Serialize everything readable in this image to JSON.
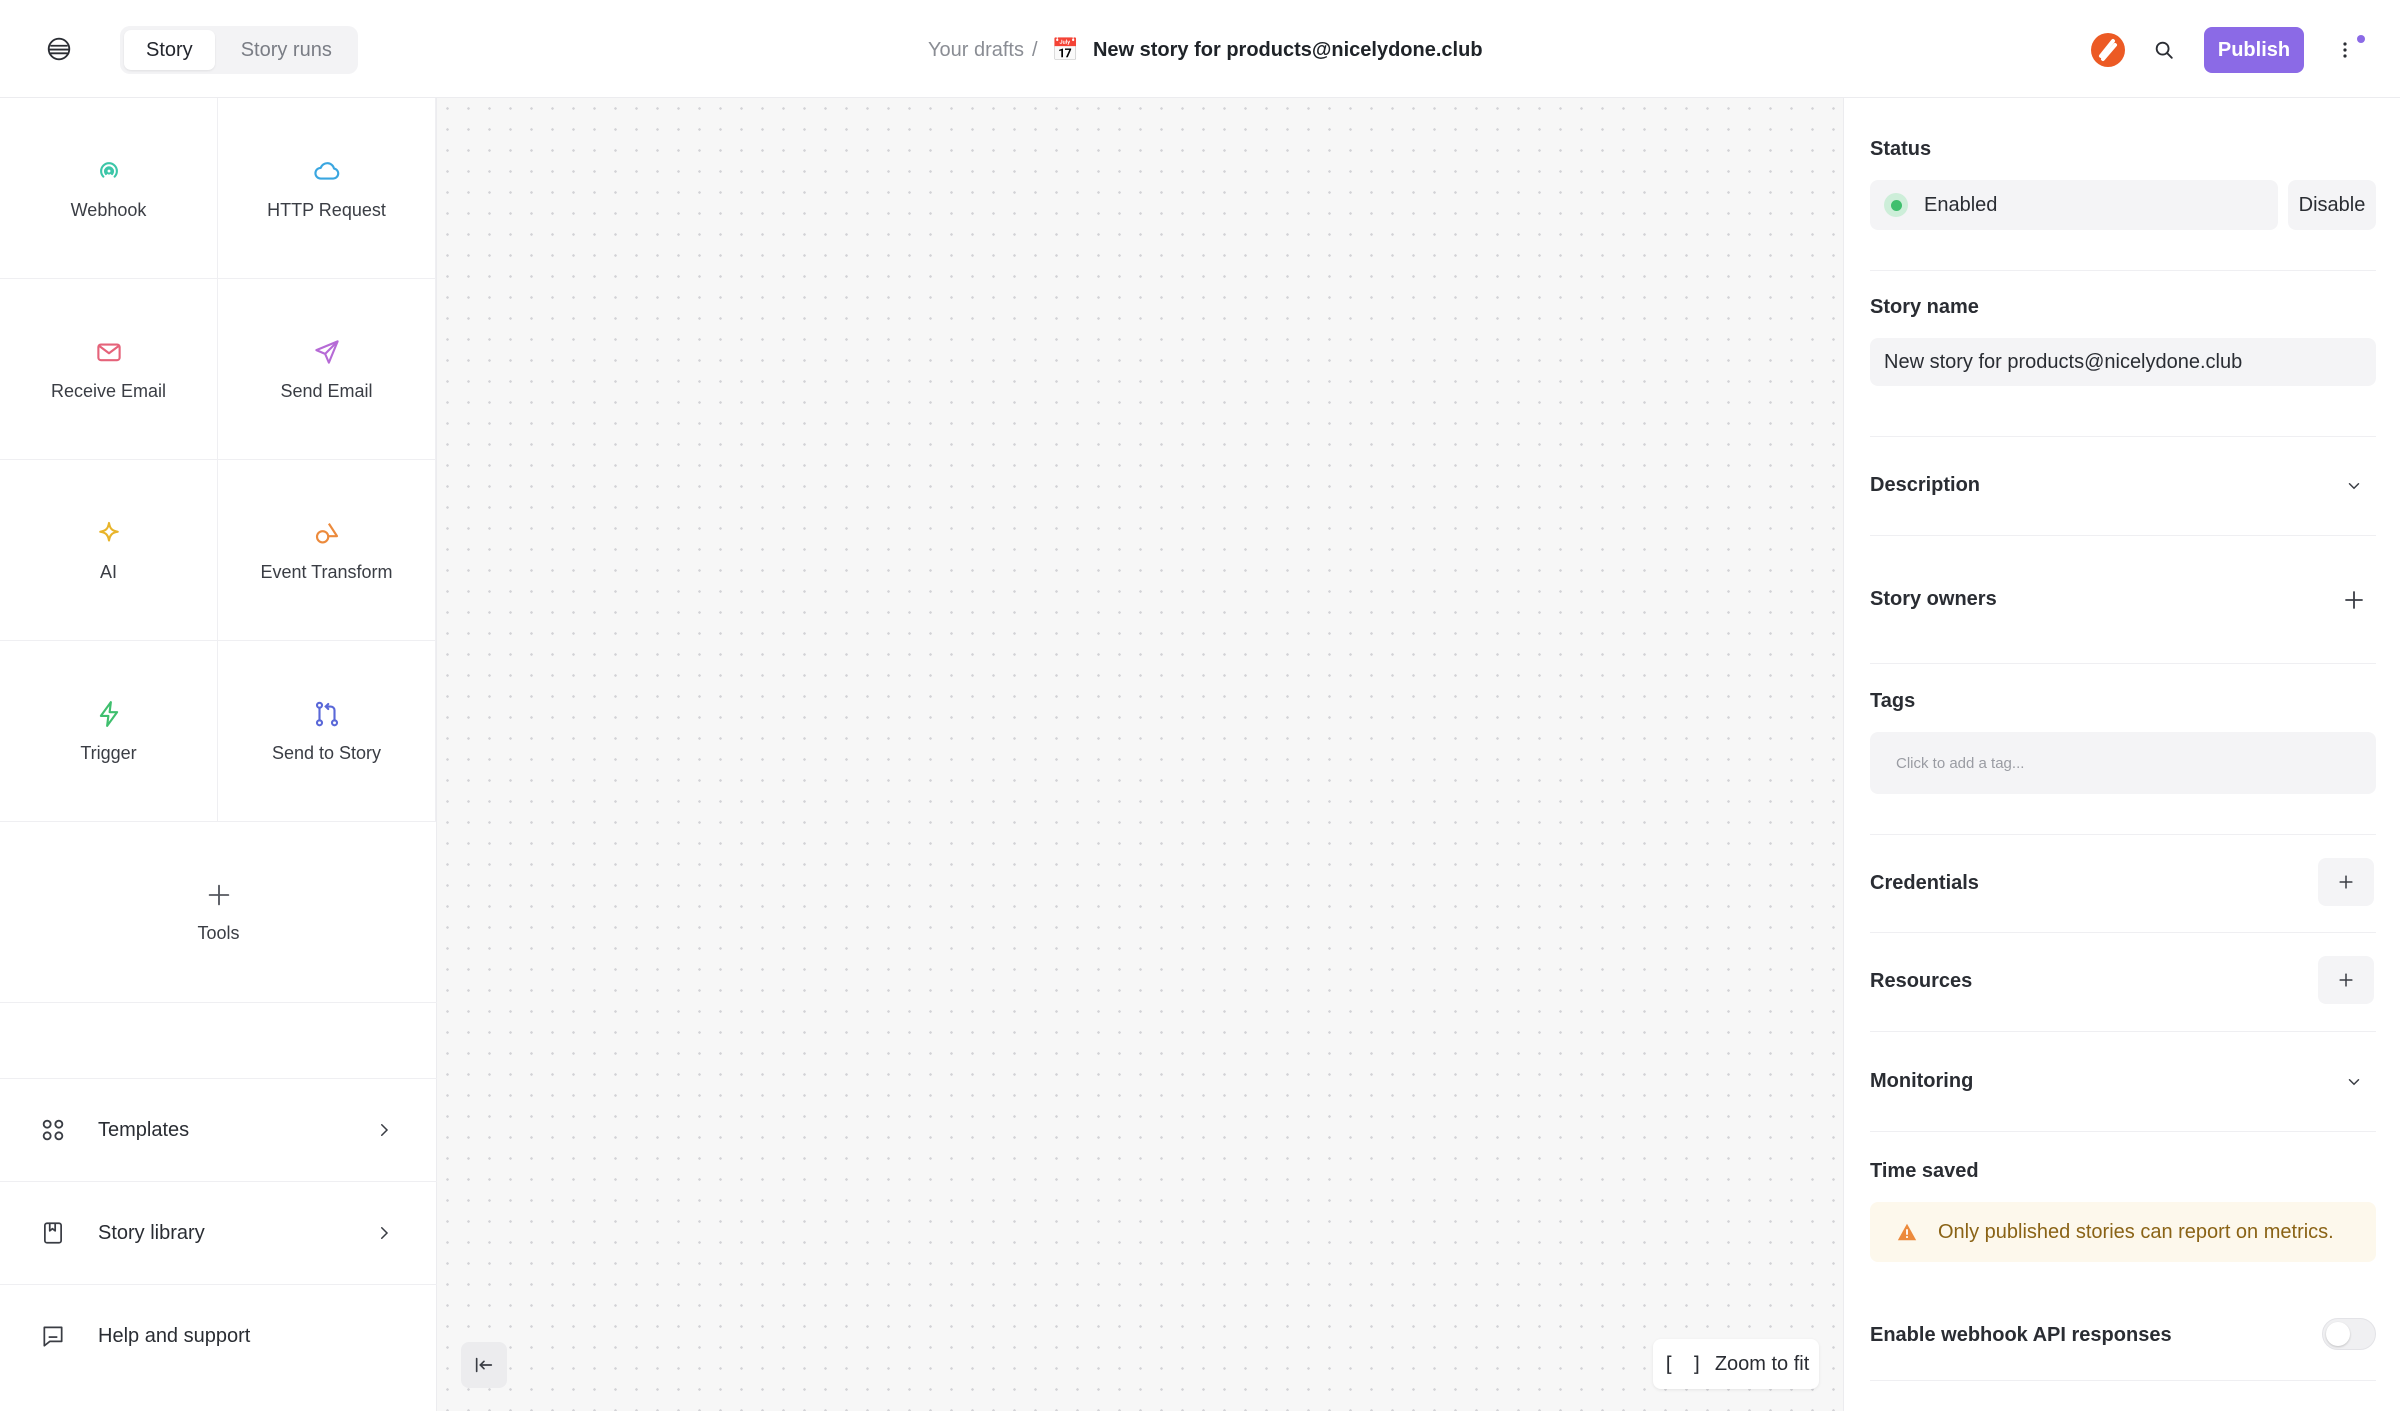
{
  "header": {
    "menu_icon": "stack-icon",
    "tabs": [
      {
        "label": "Story",
        "active": true
      },
      {
        "label": "Story runs",
        "active": false
      }
    ],
    "breadcrumb": {
      "parent": "Your drafts",
      "separator": "/",
      "emoji": "📅",
      "title": "New story for products@nicelydone.club"
    },
    "publish_label": "Publish",
    "accent_color": "#8b6ae6"
  },
  "actions": [
    {
      "label": "Webhook",
      "icon": "webhook-icon",
      "color": "#3cc6a8"
    },
    {
      "label": "HTTP Request",
      "icon": "cloud-icon",
      "color": "#3aa6e0"
    },
    {
      "label": "Receive Email",
      "icon": "mail-icon",
      "color": "#e5637a"
    },
    {
      "label": "Send Email",
      "icon": "send-icon",
      "color": "#b66ad6"
    },
    {
      "label": "AI",
      "icon": "sparkle-icon",
      "color": "#e8b42a"
    },
    {
      "label": "Event Transform",
      "icon": "shapes-icon",
      "color": "#ec8a3c"
    },
    {
      "label": "Trigger",
      "icon": "bolt-icon",
      "color": "#3fbf6e"
    },
    {
      "label": "Send to Story",
      "icon": "git-merge-icon",
      "color": "#5a68d8"
    },
    {
      "label": "Tools",
      "icon": "plus-icon",
      "color": "#55585f"
    }
  ],
  "sidebar_links": [
    {
      "label": "Templates",
      "icon": "grid-icon"
    },
    {
      "label": "Story library",
      "icon": "book-icon"
    },
    {
      "label": "Help and support",
      "icon": "chat-icon"
    }
  ],
  "canvas": {
    "zoom_label": "Zoom to fit",
    "zoom_icon": "brackets-icon",
    "collapse_icon": "collapse-left-icon"
  },
  "panel": {
    "status": {
      "title": "Status",
      "value": "Enabled",
      "action": "Disable",
      "color": "#3fbf6e"
    },
    "story_name": {
      "title": "Story name",
      "value": "New story for products@nicelydone.club"
    },
    "description": {
      "title": "Description"
    },
    "owners": {
      "title": "Story owners"
    },
    "tags": {
      "title": "Tags",
      "placeholder": "Click to add a tag..."
    },
    "credentials": {
      "title": "Credentials"
    },
    "resources": {
      "title": "Resources"
    },
    "monitoring": {
      "title": "Monitoring"
    },
    "time_saved": {
      "title": "Time saved",
      "notice": "Only published stories can report on metrics.",
      "warn_color": "#ec8a3c"
    },
    "webhook_api": {
      "title": "Enable webhook API responses",
      "enabled": false
    }
  }
}
